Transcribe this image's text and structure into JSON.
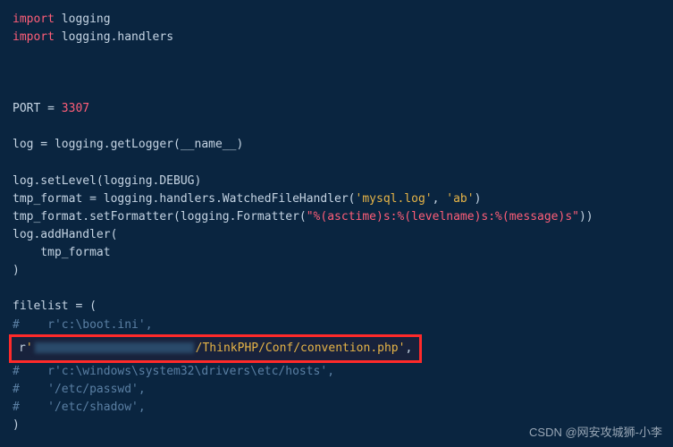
{
  "lines": {
    "l1_kw": "import",
    "l1_mod": " logging",
    "l2_kw": "import",
    "l2_mod": " logging.handlers",
    "port_lhs": "PORT = ",
    "port_num": "3307",
    "log_assign": "log = logging.getLogger(__name__)",
    "setlevel": "log.setLevel(logging.DEBUG)",
    "tmpformat_lhs": "tmp_format = logging.handlers.WatchedFileHandler(",
    "tmpformat_s1": "'mysql.log'",
    "tmpformat_mid": ", ",
    "tmpformat_s2": "'ab'",
    "tmpformat_end": ")",
    "setformatter_lhs": "tmp_format.setFormatter(logging.Formatter(",
    "setformatter_str": "\"%(asctime)s:%(levelname)s:%(message)s\"",
    "setformatter_end": "))",
    "addhandler_open": "log.addHandler(",
    "addhandler_arg": "    tmp_format",
    "addhandler_close": ")",
    "filelist_open": "filelist = (",
    "c_boot_pre": "#    r",
    "c_boot_str": "'c:\\boot.ini'",
    "c_boot_end": ",",
    "hl_pre": "    r",
    "hl_prefix": "'",
    "hl_path": "/ThinkPHP/Conf/convention.php'",
    "hl_end": ",",
    "c_hosts_pre": "#    r",
    "c_hosts_str": "'c:\\windows\\system32\\drivers\\etc/hosts'",
    "c_hosts_end": ",",
    "c_passwd_pre": "#    ",
    "c_passwd_str": "'/etc/passwd'",
    "c_passwd_end": ",",
    "c_shadow_pre": "#    ",
    "c_shadow_str": "'/etc/shadow'",
    "c_shadow_end": ",",
    "close_paren": ")"
  },
  "watermark": "CSDN @网安攻城狮-小李"
}
